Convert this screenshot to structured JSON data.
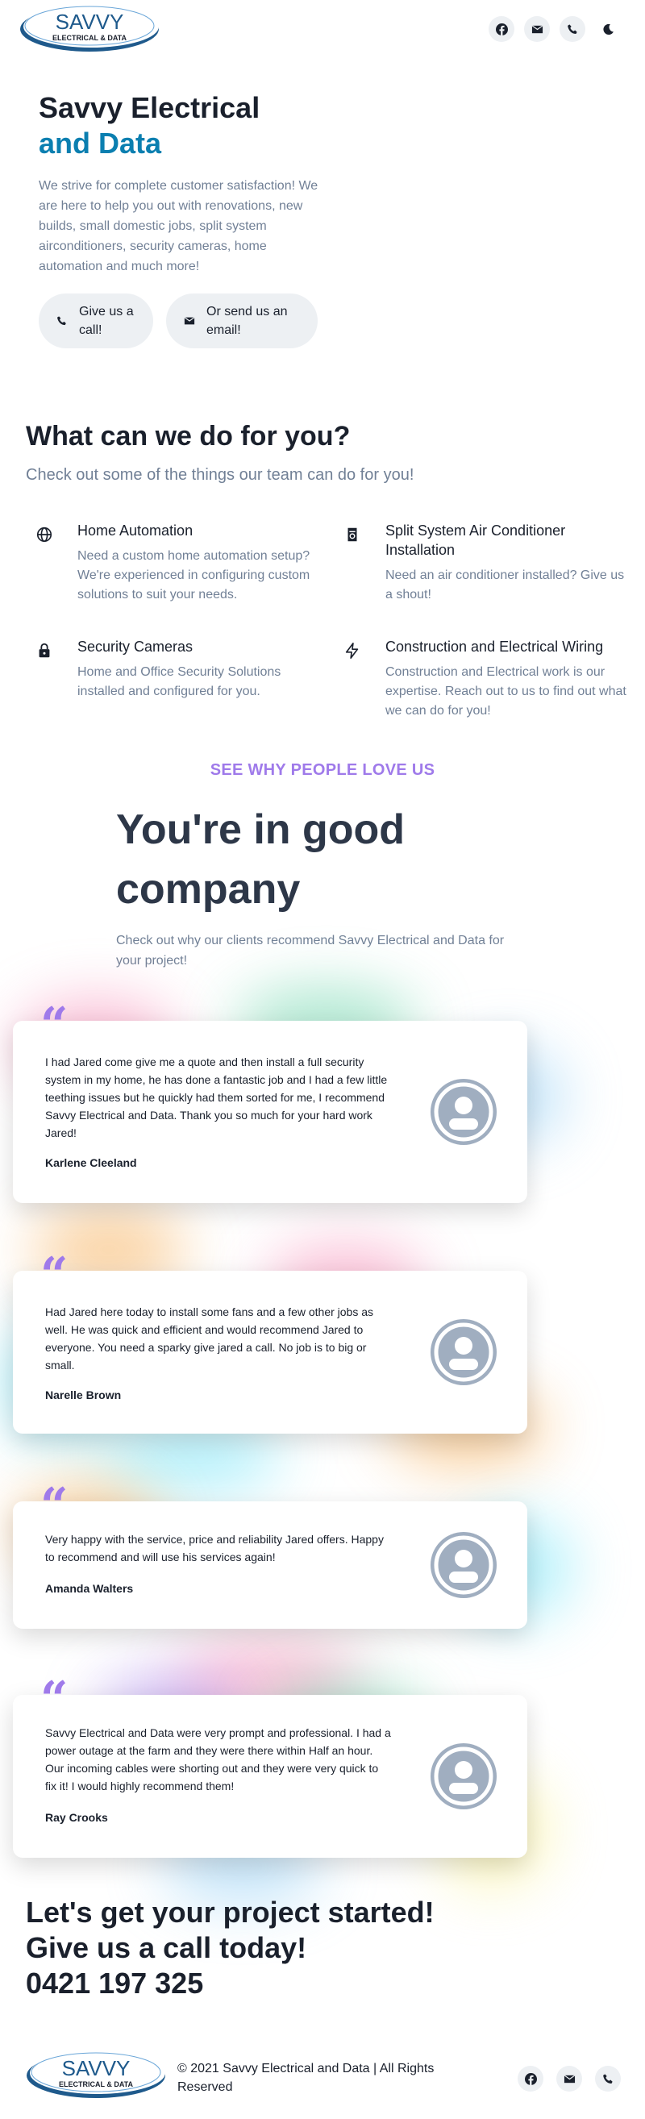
{
  "brand": {
    "logo_line1": "SAVVY",
    "logo_line2": "ELECTRICAL & DATA",
    "accent": "#0b7fb0",
    "kicker_color": "#9f7aea"
  },
  "header": {
    "icons": [
      "facebook-icon",
      "email-icon",
      "phone-icon",
      "moon-icon"
    ]
  },
  "hero": {
    "title_line1": "Savvy Electrical",
    "title_line2": "and Data",
    "description": "We strive for complete customer satisfaction! We are here to help you out with renovations, new builds, small domestic jobs, split system airconditioners, security cameras, home automation and much more!",
    "call_button": "Give us a call!",
    "email_button": "Or send us an email!"
  },
  "services": {
    "title": "What can we do for you?",
    "subtitle": "Check out some of the things our team can do for you!",
    "items": [
      {
        "icon": "globe-icon",
        "title": "Home Automation",
        "description": "Need a custom home automation setup? We're experienced in configuring custom solutions to suit your needs."
      },
      {
        "icon": "air-conditioner-icon",
        "title": "Split System Air Conditioner Installation",
        "description": "Need an air conditioner installed? Give us a shout!"
      },
      {
        "icon": "lock-icon",
        "title": "Security Cameras",
        "description": "Home and Office Security Solutions installed and configured for you."
      },
      {
        "icon": "lightning-icon",
        "title": "Construction and Electrical Wiring",
        "description": "Construction and Electrical work is our expertise. Reach out to us to find out what we can do for you!"
      }
    ]
  },
  "testimonials": {
    "kicker": "SEE WHY PEOPLE LOVE US",
    "title": "You're in good company",
    "subtitle": "Check out why our clients recommend Savvy Electrical and Data for your project!",
    "quote_mark": "“",
    "items": [
      {
        "text": "I had Jared come give me a quote and then install a full security system in my home, he has done a fantastic job and I had a few little teething issues but he quickly had them sorted for me, I recommend Savvy Electrical and Data. Thank you so much for your hard work Jared!",
        "name": "Karlene Cleeland"
      },
      {
        "text": "Had Jared here today to install some fans and a few other jobs as well. He was quick and efficient and would recommend Jared to everyone. You need a sparky give jared a call. No job is to big or small.",
        "name": "Narelle Brown"
      },
      {
        "text": "Very happy with the service, price and reliability Jared offers. Happy to recommend and will use his services again!",
        "name": "Amanda Walters"
      },
      {
        "text": "Savvy Electrical and Data were very prompt and professional. I had a power outage at the farm and they were there within Half an hour. Our incoming cables were shorting out and they were very quick to fix it! I would highly recommend them!",
        "name": "Ray Crooks"
      }
    ]
  },
  "cta": {
    "line1": "Let's get your project started!",
    "line2": "Give us a call today!",
    "phone": "0421 197 325"
  },
  "footer": {
    "copyright": "© 2021 Savvy Electrical and Data | All Rights Reserved",
    "icons": [
      "facebook-icon",
      "email-icon",
      "phone-icon"
    ]
  }
}
